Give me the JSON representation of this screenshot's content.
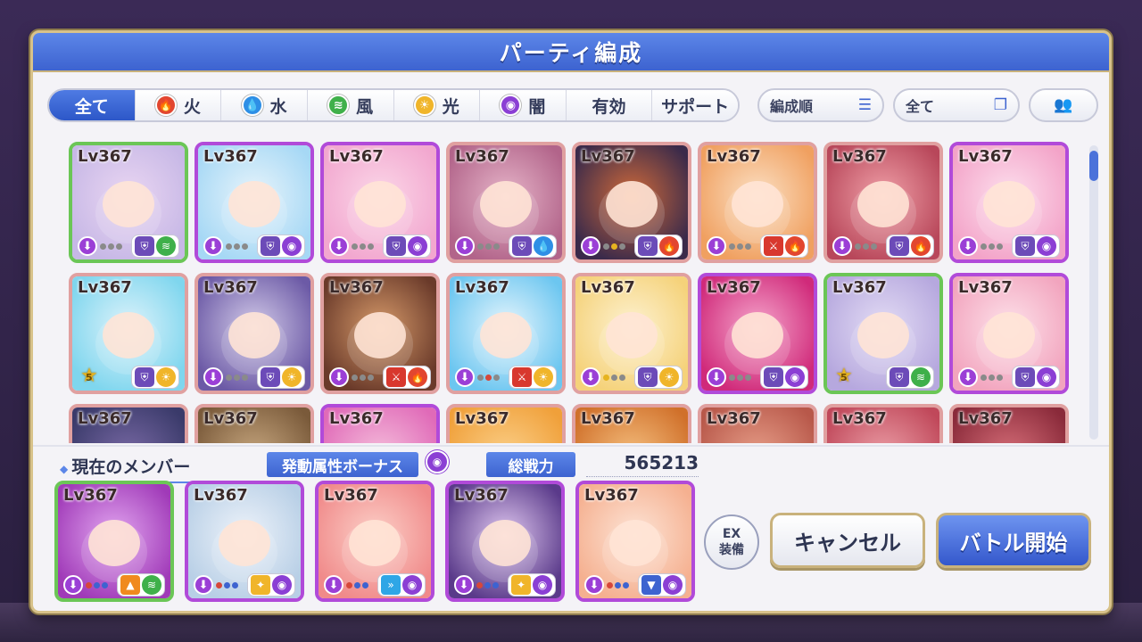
{
  "title": "パーティ編成",
  "tabs": [
    {
      "label": "全て",
      "icon": "",
      "active": true
    },
    {
      "label": "火",
      "icon": "fire-icon",
      "color": "#e2462f"
    },
    {
      "label": "水",
      "icon": "water-icon",
      "color": "#2e8fe6"
    },
    {
      "label": "風",
      "icon": "wind-icon",
      "color": "#3fb04a"
    },
    {
      "label": "光",
      "icon": "light-icon",
      "color": "#f0b52a"
    },
    {
      "label": "闇",
      "icon": "dark-icon",
      "color": "#8b3fd4"
    },
    {
      "label": "有効",
      "icon": ""
    },
    {
      "label": "サポート",
      "icon": ""
    }
  ],
  "sort_label": "編成順",
  "filter_label": "全て",
  "grid": {
    "rows": [
      [
        {
          "lv": "Lv367",
          "border": "green",
          "bg": "#c7b8e6",
          "bg2": "#ead6f2",
          "badge": "rank",
          "pips": [
            "off",
            "off",
            "off"
          ],
          "icons": [
            "i-shield",
            "i-wind"
          ]
        },
        {
          "lv": "Lv367",
          "border": "purple",
          "bg": "#a6d8f5",
          "bg2": "#e8f4fb",
          "badge": "rank",
          "pips": [
            "off",
            "off",
            "off"
          ],
          "icons": [
            "i-shield",
            "i-dark"
          ]
        },
        {
          "lv": "Lv367",
          "border": "purple",
          "bg": "#f2a7cf",
          "bg2": "#fbd7e8",
          "badge": "rank",
          "pips": [
            "off",
            "off",
            "off"
          ],
          "icons": [
            "i-shield",
            "i-dark"
          ]
        },
        {
          "lv": "Lv367",
          "border": "pink",
          "bg": "#b2648a",
          "bg2": "#e6b5c9",
          "badge": "rank",
          "pips": [
            "off",
            "off",
            "off"
          ],
          "icons": [
            "i-shield",
            "i-water"
          ]
        },
        {
          "lv": "Lv367",
          "border": "pink",
          "bg": "#3a2a4a",
          "bg2": "#d06a3a",
          "badge": "rank",
          "pips": [
            "off",
            "on-yellow",
            "off"
          ],
          "icons": [
            "i-shield",
            "i-fire"
          ]
        },
        {
          "lv": "Lv367",
          "border": "pink",
          "bg": "#f0a060",
          "bg2": "#fbe0c4",
          "badge": "rank",
          "pips": [
            "off",
            "off",
            "off"
          ],
          "icons": [
            "i-sword",
            "i-fire"
          ]
        },
        {
          "lv": "Lv367",
          "border": "pink",
          "bg": "#b8475a",
          "bg2": "#f0a0a8",
          "badge": "rank",
          "pips": [
            "off",
            "off",
            "off"
          ],
          "icons": [
            "i-shield",
            "i-fire"
          ]
        },
        {
          "lv": "Lv367",
          "border": "purple",
          "bg": "#f3a3c8",
          "bg2": "#fde0ee",
          "badge": "rank",
          "pips": [
            "off",
            "off",
            "off"
          ],
          "icons": [
            "i-shield",
            "i-dark"
          ]
        }
      ],
      [
        {
          "lv": "Lv367",
          "border": "pink",
          "bg": "#7fd6ee",
          "bg2": "#dff3fb",
          "badge": "star",
          "star_num": "5",
          "pips": [],
          "icons": [
            "i-shield",
            "i-light"
          ]
        },
        {
          "lv": "Lv367",
          "border": "pink",
          "bg": "#6c5aa6",
          "bg2": "#d3cbe9",
          "badge": "rank",
          "pips": [
            "off",
            "off",
            "off"
          ],
          "icons": [
            "i-shield",
            "i-light"
          ]
        },
        {
          "lv": "Lv367",
          "border": "pink",
          "bg": "#6a3a2a",
          "bg2": "#d69a6a",
          "badge": "rank",
          "pips": [
            "off",
            "off",
            "off"
          ],
          "icons": [
            "i-sword",
            "i-fire"
          ]
        },
        {
          "lv": "Lv367",
          "border": "pink",
          "bg": "#6cc6f0",
          "bg2": "#e8f6fd",
          "badge": "rank",
          "pips": [
            "off",
            "on-red",
            "off"
          ],
          "icons": [
            "i-sword",
            "i-light"
          ]
        },
        {
          "lv": "Lv367",
          "border": "pink",
          "bg": "#f5d27a",
          "bg2": "#fdf2d2",
          "badge": "rank",
          "pips": [
            "on-yellow",
            "off",
            "off"
          ],
          "icons": [
            "i-shield",
            "i-light"
          ]
        },
        {
          "lv": "Lv367",
          "border": "purple",
          "bg": "#d02a7a",
          "bg2": "#f5a6cc",
          "badge": "rank",
          "pips": [
            "off",
            "off",
            "off"
          ],
          "icons": [
            "i-shield",
            "i-dark"
          ]
        },
        {
          "lv": "Lv367",
          "border": "green",
          "bg": "#b6a8de",
          "bg2": "#e4ddf5",
          "badge": "star",
          "star_num": "5",
          "pips": [],
          "icons": [
            "i-shield",
            "i-wind"
          ]
        },
        {
          "lv": "Lv367",
          "border": "purple",
          "bg": "#f2a4be",
          "bg2": "#fde2ea",
          "badge": "rank",
          "pips": [
            "off",
            "off",
            "off"
          ],
          "icons": [
            "i-shield",
            "i-dark"
          ]
        }
      ],
      [
        {
          "lv": "Lv367",
          "border": "pink",
          "bg": "#3a3a6a",
          "bg2": "#7a6aa6",
          "badge": "",
          "pips": [],
          "icons": []
        },
        {
          "lv": "Lv367",
          "border": "pink",
          "bg": "#7a5a3a",
          "bg2": "#c8a880",
          "badge": "",
          "pips": [],
          "icons": []
        },
        {
          "lv": "Lv367",
          "border": "purple",
          "bg": "#e06ab8",
          "bg2": "#f5c0dc",
          "badge": "",
          "pips": [],
          "icons": []
        },
        {
          "lv": "Lv367",
          "border": "pink",
          "bg": "#f0a03a",
          "bg2": "#fbd08a",
          "badge": "",
          "pips": [],
          "icons": []
        },
        {
          "lv": "Lv367",
          "border": "pink",
          "bg": "#d0702a",
          "bg2": "#f5c080",
          "badge": "",
          "pips": [],
          "icons": []
        },
        {
          "lv": "Lv367",
          "border": "pink",
          "bg": "#b8584a",
          "bg2": "#e8a08a",
          "badge": "",
          "pips": [],
          "icons": []
        },
        {
          "lv": "Lv367",
          "border": "pink",
          "bg": "#c0485a",
          "bg2": "#eca0a8",
          "badge": "",
          "pips": [],
          "icons": []
        },
        {
          "lv": "Lv367",
          "border": "pink",
          "bg": "#8a2a3a",
          "bg2": "#d8707a",
          "badge": "",
          "pips": [],
          "icons": []
        }
      ]
    ]
  },
  "current_members_label": "現在のメンバー",
  "bonus_label": "発動属性ボーナス",
  "bonus_icon": "dark-icon",
  "power_label": "総戦力",
  "power_value": "565213",
  "party": [
    {
      "lv": "Lv367",
      "border": "green",
      "bg": "#a03ab8",
      "bg2": "#e2a6f0",
      "pips": [
        "on-red",
        "on-blue",
        "on-blue"
      ],
      "icons": [
        "i-up",
        "i-wind"
      ]
    },
    {
      "lv": "Lv367",
      "border": "purple",
      "bg": "#b8cfe6",
      "bg2": "#eef3fa",
      "pips": [
        "on-red",
        "on-blue",
        "on-blue"
      ],
      "icons": [
        "i-buff",
        "i-dark"
      ]
    },
    {
      "lv": "Lv367",
      "border": "purple",
      "bg": "#f08a8a",
      "bg2": "#fcd0c8",
      "pips": [
        "on-red",
        "on-blue",
        "on-blue"
      ],
      "icons": [
        "i-speed",
        "i-dark"
      ]
    },
    {
      "lv": "Lv367",
      "border": "purple",
      "bg": "#5a3a8a",
      "bg2": "#e0c8f0",
      "pips": [
        "on-red",
        "on-blue",
        "on-blue"
      ],
      "icons": [
        "i-buff",
        "i-dark"
      ]
    },
    {
      "lv": "Lv367",
      "border": "purple",
      "bg": "#f5b090",
      "bg2": "#fde4d6",
      "pips": [
        "on-red",
        "on-blue",
        "on-blue"
      ],
      "icons": [
        "i-down",
        "i-dark"
      ]
    }
  ],
  "ex_button_line1": "EX",
  "ex_button_line2": "装備",
  "cancel_label": "キャンセル",
  "start_label": "バトル開始",
  "colors": {
    "accent": "#3d63d0",
    "border_pink": "#e0a0a0",
    "border_purple": "#b14ad9",
    "border_green": "#6bc656"
  }
}
